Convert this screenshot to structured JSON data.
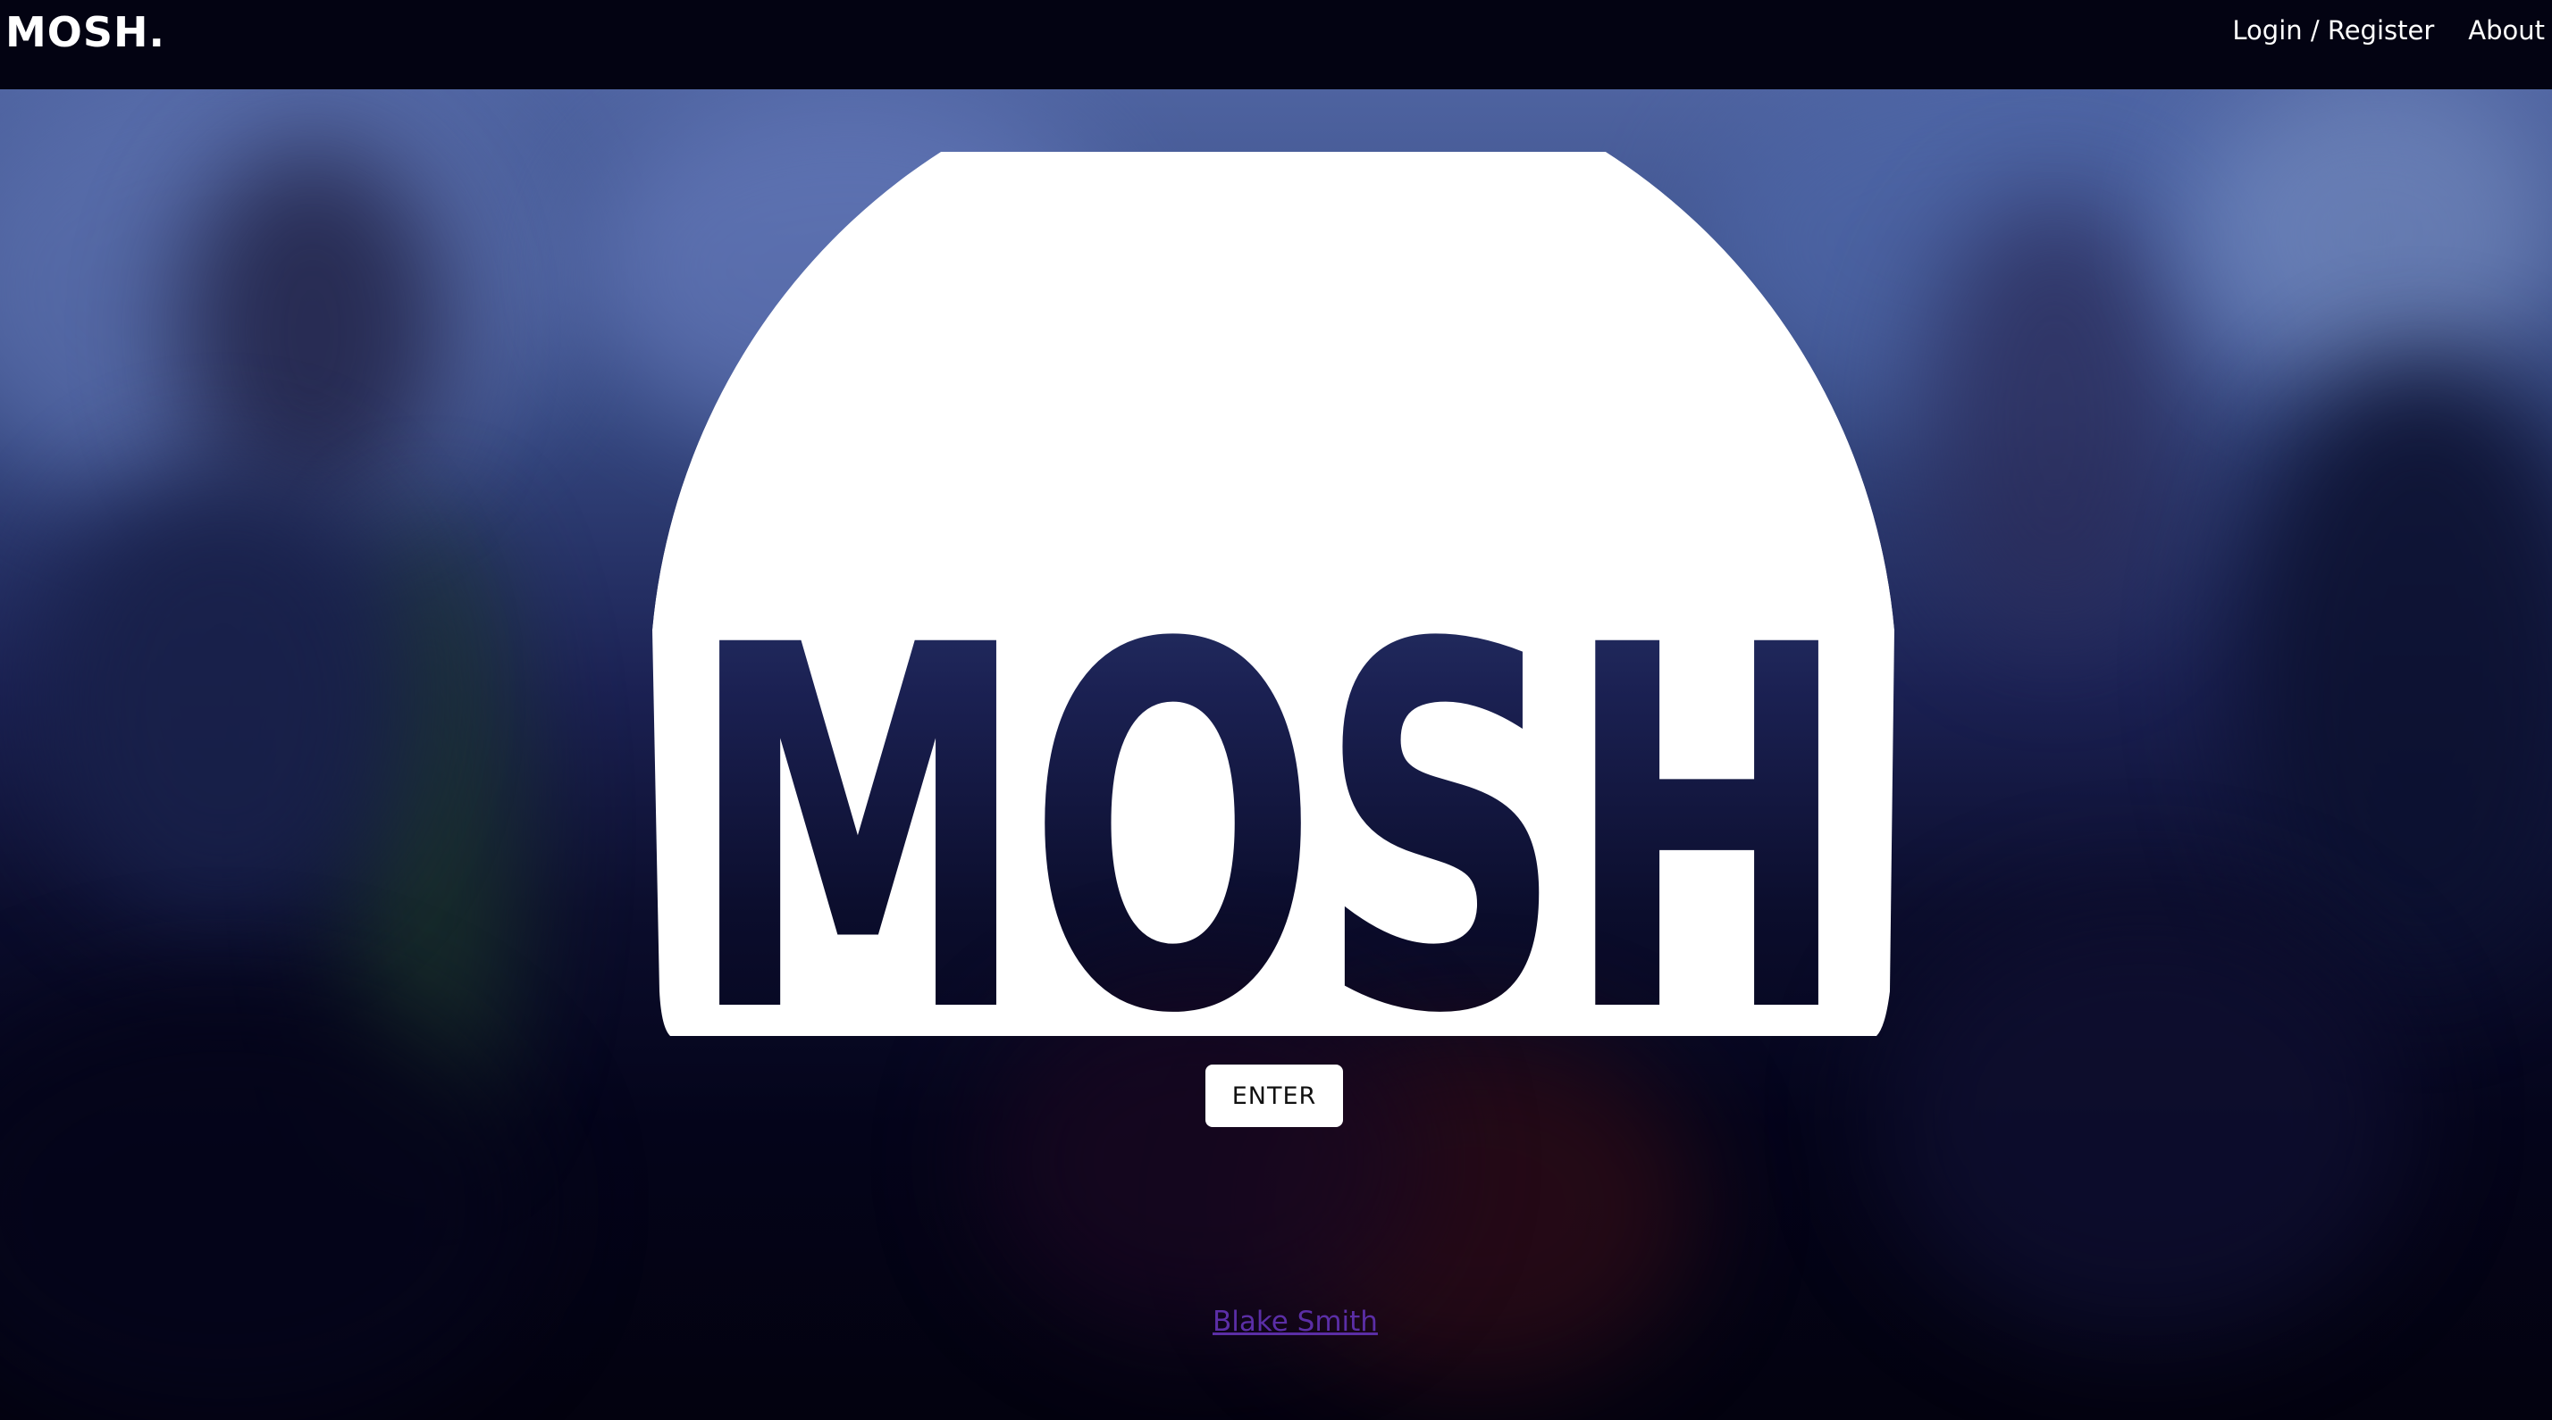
{
  "navbar": {
    "brand": "MOSH.",
    "links": [
      {
        "label": "Login / Register"
      },
      {
        "label": "About"
      }
    ]
  },
  "hero": {
    "logo_text": "MOSH",
    "enter_label": "ENTER",
    "credit": "Blake Smith"
  },
  "colors": {
    "navbar_bg": "#030312",
    "credit_link": "#5b2ea6",
    "logo_fill": "#ffffff"
  }
}
